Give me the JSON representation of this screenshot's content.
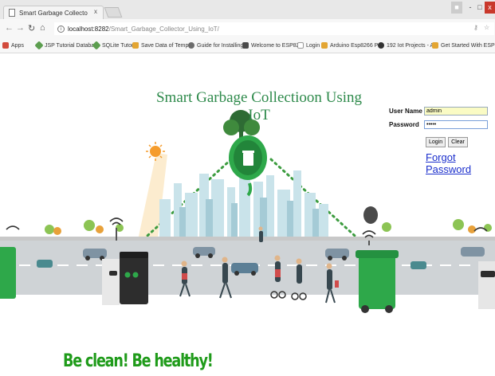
{
  "browser": {
    "tab_title": "Smart Garbage Collecto",
    "tab_close": "x",
    "url_host": "localhost:8282",
    "url_path": "/Smart_Garbage_Collector_Using_IoT/",
    "window_controls": [
      "-",
      "□",
      "x"
    ],
    "bookmarks": [
      {
        "label": "Apps",
        "color": "#d24b3c"
      },
      {
        "label": "JSP Tutorial Databas",
        "color": "#5c9e4f"
      },
      {
        "label": "SQLite Tutorial",
        "color": "#5c9e4f"
      },
      {
        "label": "Save Data of Tempe",
        "color": "#e3a532"
      },
      {
        "label": "Guide for Installing",
        "color": "#6b6b6b"
      },
      {
        "label": "Welcome to ESP826",
        "color": "#4b4b4b"
      },
      {
        "label": "Login",
        "color": "#9a9a9a"
      },
      {
        "label": "Arduino Esp8266 Po",
        "color": "#e3a532"
      },
      {
        "label": "192 Iot Projects - Ar",
        "color": "#333333"
      },
      {
        "label": "Get Started With ESP",
        "color": "#e3a532"
      }
    ]
  },
  "page": {
    "title": "Smart Garbage Collectioon Using IoT",
    "slogan": "Be clean! Be healthy!"
  },
  "login": {
    "username_label": "User Name",
    "username_value": "admin",
    "password_label": "Password",
    "password_value": "•••••",
    "login_button": "Login",
    "clear_button": "Clear",
    "forgot_link": "Forgot Password"
  },
  "colors": {
    "title_green": "#2e8a4b",
    "slogan_green": "#1f9b1a",
    "link_blue": "#1a2ecc",
    "bin_green": "#2ea84a"
  }
}
